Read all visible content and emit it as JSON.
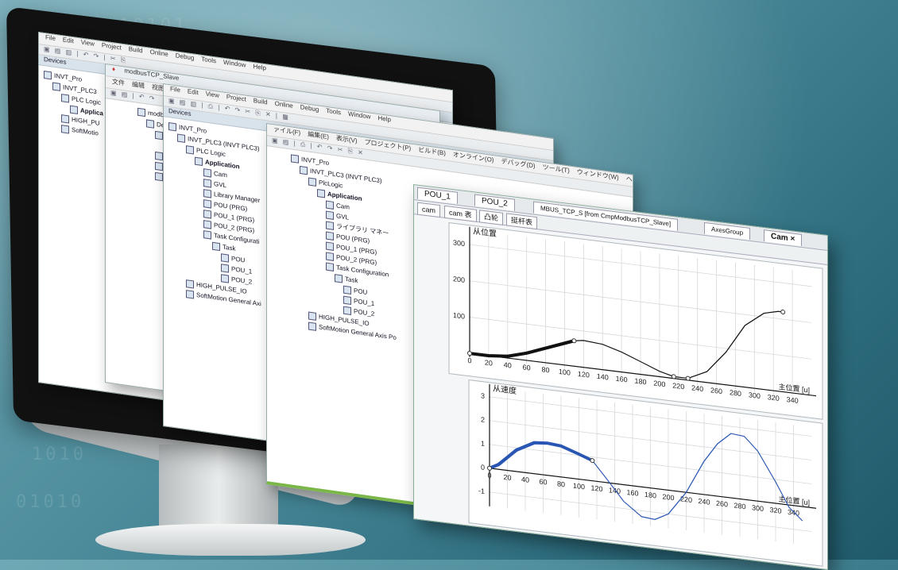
{
  "background_binary": [
    "1010",
    "1010",
    "010101",
    "1010",
    "01010",
    "10101"
  ],
  "win1": {
    "menu": [
      "File",
      "Edit",
      "View",
      "Project",
      "Build",
      "Online",
      "Debug",
      "Tools",
      "Window",
      "Help"
    ],
    "panel": "Devices",
    "tree": [
      "INVT_Pro",
      "INVT_PLC3",
      "PLC Logic",
      "Applica",
      "HIGH_PU",
      "SoftMotio"
    ]
  },
  "win2": {
    "title": "modbusTCP_Slave",
    "menu": [
      "文件",
      "编辑",
      "视图"
    ],
    "tree": [
      "modbusTCP_Slave",
      "Device (INVT",
      "PLC",
      "Applicat",
      "ModbusT",
      "EtherCA",
      "SoftMot"
    ]
  },
  "win3": {
    "menu": [
      "File",
      "Edit",
      "View",
      "Project",
      "Build",
      "Online",
      "Debug",
      "Tools",
      "Window",
      "Help"
    ],
    "panel": "Devices",
    "tree": [
      "INVT_Pro",
      "INVT_PLC3 (INVT PLC3)",
      "PLC Logic",
      "Application",
      "Cam",
      "GVL",
      "Library Manager",
      "POU (PRG)",
      "POU_1 (PRG)",
      "POU_2 (PRG)",
      "Task Configurati",
      "Task",
      "POU",
      "POU_1",
      "POU_2",
      "HIGH_PULSE_IO",
      "SoftMotion General Axi"
    ]
  },
  "win4": {
    "menu": [
      "ァイル(F)",
      "編集(E)",
      "表示(V)",
      "プロジェクト(P)",
      "ビルド(B)",
      "オンライン(O)",
      "デバッグ(D)",
      "ツール(T)",
      "ウィンドウ(W)",
      "ヘルプ(H)"
    ],
    "tree": [
      "INVT_Pro",
      "INVT_PLC3 (INVT PLC3)",
      "PlcLogic",
      "Application",
      "Cam",
      "GVL",
      "ライブラリ マネー",
      "POU (PRG)",
      "POU_1 (PRG)",
      "POU_2 (PRG)",
      "Task Configuration",
      "Task",
      "POU",
      "POU_1",
      "POU_2",
      "HIGH_PULSE_IO",
      "SoftMotion General Axis Po"
    ]
  },
  "plot_window": {
    "tabs_top": [
      "POU_1",
      "POU_2",
      "MBUS_TCP_S [from CmpModbusTCP_Slave]",
      "AxesGroup",
      "Cam"
    ],
    "tabs_second": [
      "cam",
      "cam 表",
      "凸轮",
      "挺杆表"
    ],
    "close": "×"
  },
  "chart_data": [
    {
      "type": "line",
      "ylabel": "从位置",
      "xlabel": "主位置 [u]",
      "xticks": [
        0,
        20,
        40,
        60,
        80,
        100,
        120,
        140,
        160,
        180,
        200,
        220,
        240,
        260,
        280,
        300,
        320,
        340
      ],
      "yticks": [
        100,
        200,
        300
      ],
      "xlim": [
        0,
        360
      ],
      "ylim": [
        -10,
        340
      ],
      "series": [
        {
          "x": [
            0,
            20,
            40,
            60,
            80,
            100,
            110,
            120,
            140,
            160,
            180,
            200,
            215,
            230,
            250,
            270,
            290,
            310,
            325,
            330
          ],
          "values": [
            0,
            0,
            5,
            20,
            40,
            60,
            70,
            74,
            70,
            55,
            35,
            15,
            5,
            5,
            30,
            90,
            170,
            210,
            220,
            220
          ]
        }
      ],
      "grid": true
    },
    {
      "type": "line",
      "ylabel": "从速度",
      "xlabel": "主位置 [u]",
      "xticks": [
        0,
        20,
        40,
        60,
        80,
        100,
        120,
        140,
        160,
        180,
        200,
        220,
        240,
        260,
        280,
        300,
        320,
        340
      ],
      "yticks": [
        -1,
        0,
        1,
        2,
        3
      ],
      "xlim": [
        0,
        360
      ],
      "ylim": [
        -1.6,
        3.4
      ],
      "series": [
        {
          "x": [
            0,
            10,
            30,
            50,
            65,
            80,
            100,
            115,
            130,
            150,
            170,
            185,
            200,
            220,
            240,
            255,
            270,
            285,
            300,
            320,
            335,
            350
          ],
          "values": [
            0,
            0.2,
            0.9,
            1.3,
            1.35,
            1.3,
            1.05,
            0.85,
            0.2,
            -0.7,
            -1.25,
            -1.3,
            -1.0,
            0.0,
            1.4,
            2.2,
            2.7,
            2.65,
            2.1,
            0.9,
            -0.1,
            -0.6
          ]
        }
      ],
      "grid": true
    }
  ]
}
